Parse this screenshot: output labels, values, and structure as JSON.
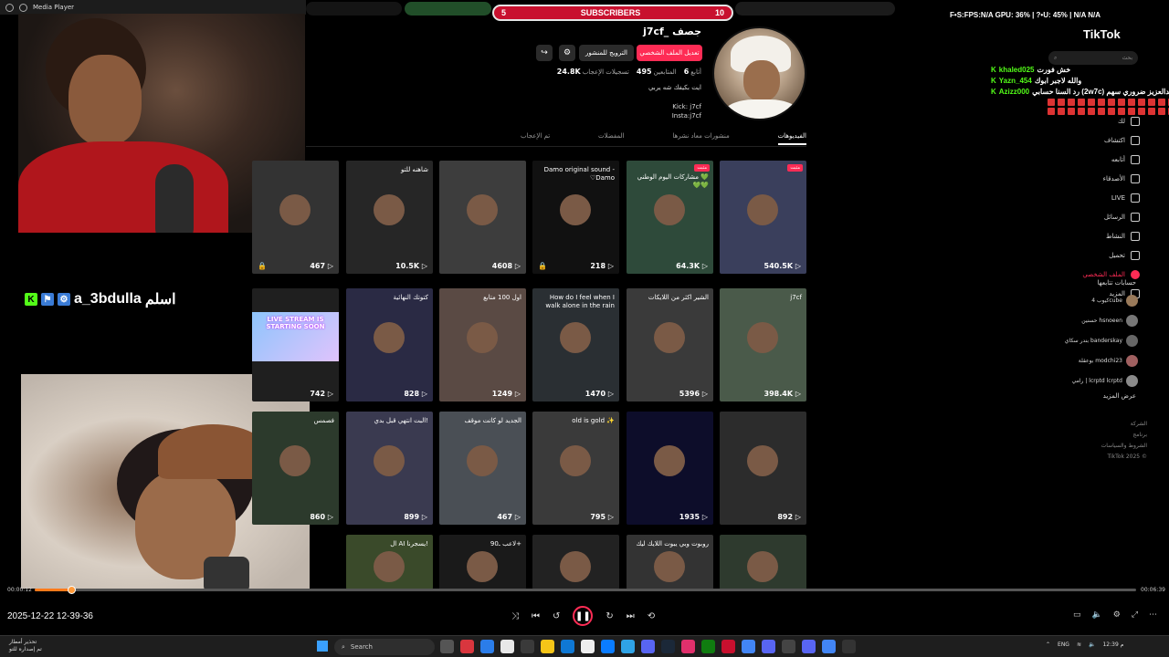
{
  "player": {
    "title": "Media Player"
  },
  "subs_bar": {
    "left_count": "5",
    "label": "SUBSCRIBERS",
    "right_count": "10"
  },
  "stats_line": "F•S:FPS:N/A GPU: 36% | ?•U: 45% | N/A N/A",
  "profile": {
    "username": "j7cf_ جصف",
    "edit_button": "تعديل الملف الشخصي",
    "promote_button": "الترويج للمنشور",
    "following_count": "6",
    "following_label": "أتابع",
    "followers_count": "495",
    "followers_label": "المتابعين",
    "likes_count": "24.8K",
    "likes_label": "تسجيلات الإعجاب",
    "bio": "ايت بكيفك شه يربي",
    "link1": "Kick: j7cf",
    "link2": "Insta:j7cf"
  },
  "tabs": [
    {
      "label": "الفيديوهات"
    },
    {
      "label": "منشورات معاد نشرها"
    },
    {
      "label": "المفضلات"
    },
    {
      "label": "تم الإعجاب"
    }
  ],
  "videos": [
    {
      "views": "540.5K",
      "caption": "",
      "badge": "مثبت",
      "color": "#3a3f5c"
    },
    {
      "views": "64.3K",
      "caption": "مشاركات اليوم الوطني 💚💚💚",
      "badge": "مثبت",
      "color": "#2e4a3a"
    },
    {
      "views": "218",
      "caption": "Damo original sound - ♡Damo",
      "badge": "",
      "color": "#111111",
      "locked": true
    },
    {
      "views": "4608",
      "caption": "",
      "badge": "",
      "color": "#3d3d3d"
    },
    {
      "views": "10.5K",
      "caption": "شاهنه للتو",
      "badge": "",
      "color": "#262626"
    },
    {
      "views": "467",
      "caption": "",
      "badge": "",
      "color": "#333333",
      "locked": true
    },
    {
      "views": "398.4K",
      "caption": "j7cf",
      "badge": "",
      "color": "#4a5a4a"
    },
    {
      "views": "5396",
      "caption": "الشير اكثر من اللايكات",
      "badge": "",
      "color": "#3a3a3a"
    },
    {
      "views": "1470",
      "caption": "How do I feel when I walk alone in the rain",
      "badge": "",
      "color": "#2a2f33"
    },
    {
      "views": "1249",
      "caption": "اول 100 متابع",
      "badge": "",
      "color": "#5a4a44"
    },
    {
      "views": "828",
      "caption": "كتوتك النهائية",
      "badge": "",
      "color": "#2a2a44"
    },
    {
      "views": "742",
      "caption": "",
      "badge": "",
      "color": "#1f1f1f"
    },
    {
      "views": "892",
      "caption": "",
      "badge": "",
      "color": "#2c2c2c"
    },
    {
      "views": "1935",
      "caption": "",
      "badge": "",
      "color": "#0d0d2a"
    },
    {
      "views": "795",
      "caption": "old is gold ✨",
      "badge": "",
      "color": "#3a3a3a"
    },
    {
      "views": "467",
      "caption": "الجديد لو كانت موقف",
      "badge": "",
      "color": "#4a4f55"
    },
    {
      "views": "899",
      "caption": "البت انتهي قبل بدي!",
      "badge": "",
      "color": "#3a3a50"
    },
    {
      "views": "860",
      "caption": "فصمس",
      "badge": "",
      "color": "#2c3a2c"
    },
    {
      "views": "",
      "caption": "",
      "badge": "",
      "color": "#2e3a2e"
    },
    {
      "views": "",
      "caption": "روبوت وبي يبوت اللايك ليك",
      "badge": "",
      "color": "#333333"
    },
    {
      "views": "",
      "caption": "",
      "badge": "",
      "color": "#222222"
    },
    {
      "views": "",
      "caption": "لاعب ـ90+",
      "badge": "",
      "color": "#1a1a1a"
    },
    {
      "views": "",
      "caption": "ال AI يسجرنا!",
      "badge": "",
      "color": "#3a4a2a"
    }
  ],
  "overlay": {
    "streamer_name": "a_3bdulla",
    "greeting": "اسلم",
    "live_card": "LIVE STREAM IS STARTING SOON"
  },
  "tiktok": {
    "logo": "TikTok",
    "search_placeholder": "بحث",
    "nav": [
      {
        "label": "لك",
        "active": false
      },
      {
        "label": "اكتشاف",
        "active": false
      },
      {
        "label": "أتابعه",
        "active": false
      },
      {
        "label": "الأصدقاء",
        "active": false
      },
      {
        "label": "LIVE",
        "active": false
      },
      {
        "label": "الرسائل",
        "active": false
      },
      {
        "label": "النشاط",
        "active": false
      },
      {
        "label": "تحميل",
        "active": false
      },
      {
        "label": "الملف الشخصي",
        "active": true
      },
      {
        "label": "المزيد",
        "active": false
      }
    ],
    "following_title": "حسابات تتابعها",
    "following": [
      {
        "name": "كيوب 4cube",
        "color": "#9a7a5a"
      },
      {
        "name": "حسنين hsnoeen",
        "color": "#777"
      },
      {
        "name": "بندر سكاي banderskay",
        "color": "#666"
      },
      {
        "name": "بوعقلة modchi23",
        "color": "#a06060"
      },
      {
        "name": "رامي | lcrptd lcrptd",
        "color": "#8a8a8a"
      }
    ],
    "see_more": "عرض المزيد",
    "footer": [
      "الشركة",
      "برنامج",
      "الشروط والسياسات",
      "TikTok 2025 ©"
    ]
  },
  "chat": [
    {
      "user": "khaled025",
      "message": "خش فورت"
    },
    {
      "user": "Yazn_454",
      "message": "والله لاجبر ابوك"
    },
    {
      "user": "Azizz000",
      "message": "رد السنا حسابي (2w7c) عبدالعزيز ضروري سهم"
    }
  ],
  "playback": {
    "elapsed": "00:00:12",
    "total": "00:06:39",
    "progress": 0.033,
    "datetime": "2025-12-22 12-39-36"
  },
  "taskbar": {
    "weather_line1": "تحذير أمطار",
    "weather_line2": "تم إصداره للتو",
    "search": "Search",
    "lang": "ENG",
    "time": "12:39 م"
  },
  "colors": {
    "accent": "#fe2c55",
    "kick_green": "#53fc18",
    "progress": "#ff7a1a"
  }
}
